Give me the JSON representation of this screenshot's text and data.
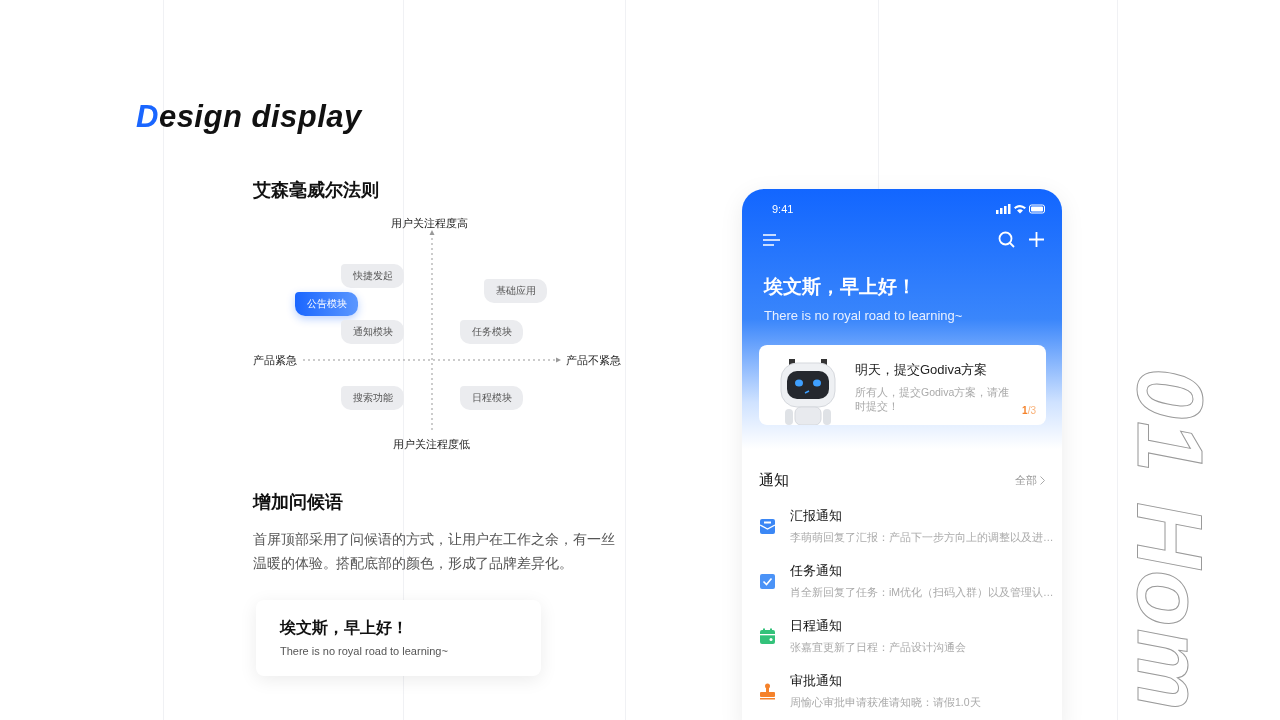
{
  "title": "Design display",
  "matrix": {
    "heading": "艾森毫威尔法则",
    "top_label": "用户关注程度高",
    "bottom_label": "用户关注程度低",
    "left_label": "产品紧急",
    "right_label": "产品不紧急",
    "tags": [
      {
        "label": "快捷发起",
        "selected": false
      },
      {
        "label": "基础应用",
        "selected": false
      },
      {
        "label": "公告模块",
        "selected": true
      },
      {
        "label": "通知模块",
        "selected": false
      },
      {
        "label": "任务模块",
        "selected": false
      },
      {
        "label": "搜索功能",
        "selected": false
      },
      {
        "label": "日程模块",
        "selected": false
      }
    ]
  },
  "greeting_section": {
    "heading": "增加问候语",
    "body": "首屏顶部采用了问候语的方式，让用户在工作之余，有一丝温暖的体验。搭配底部的颜色，形成了品牌差异化。",
    "card_title": "埃文斯，早上好！",
    "card_subtitle": "There is no royal road to learning~"
  },
  "phone": {
    "time": "9:41",
    "greeting": "埃文斯，早上好！",
    "subtitle": "There is no royal road to learning~",
    "task_card": {
      "title": "明天，提交Godiva方案",
      "description": "所有人，提交Godiva方案，请准时提交！",
      "pager": "**1**/3"
    },
    "notices": {
      "heading": "通知",
      "all_link": "全部",
      "items": [
        {
          "kind": "mail",
          "color": "#3b87f5",
          "title": "汇报通知",
          "preview": "李萌萌回复了汇报：产品下一步方向上的调整以及进…"
        },
        {
          "kind": "check",
          "color": "#4b93f7",
          "title": "任务通知",
          "preview": "肖全新回复了任务：iM优化（扫码入群）以及管理认…"
        },
        {
          "kind": "calendar",
          "color": "#33c27a",
          "title": "日程通知",
          "preview": "张嘉宜更新了日程：产品设计沟通会"
        },
        {
          "kind": "stamp",
          "color": "#f5822a",
          "title": "审批通知",
          "preview": "周愉心审批申请获准请知晓：请假1.0天"
        }
      ]
    }
  },
  "side_caption": "01 Hom"
}
